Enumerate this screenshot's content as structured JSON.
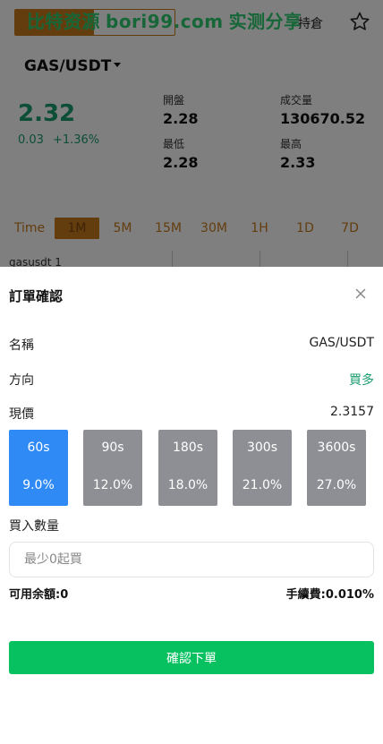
{
  "watermark": {
    "text_cn": "比特资源",
    "url": "bori99.com",
    "text_cn2": "实测分享"
  },
  "background": {
    "top_right_text": "持倉",
    "pair": "GAS/USDT",
    "price": "2.32",
    "change_abs": "0.03",
    "change_pct": "+1.36%",
    "stats": [
      {
        "label": "開盤",
        "value": "2.28"
      },
      {
        "label": "成交量",
        "value": "130670.52"
      },
      {
        "label": "最低",
        "value": "2.28"
      },
      {
        "label": "最高",
        "value": "2.33"
      }
    ],
    "intervals": [
      "Time",
      "1M",
      "5M",
      "15M",
      "30M",
      "1H",
      "1D",
      "7D"
    ],
    "active_interval": "1M",
    "sub_row": "gasusdt 1",
    "colors": {
      "accent": "#c77a1a",
      "up": "#1a9c6e"
    }
  },
  "modal": {
    "title": "訂單確認",
    "rows": [
      {
        "label": "名稱",
        "value": "GAS/USDT"
      },
      {
        "label": "方向",
        "value": "買多"
      },
      {
        "label": "現價",
        "value": "2.3157"
      }
    ],
    "periods": [
      {
        "time": "60s",
        "rate": "9.0%"
      },
      {
        "time": "90s",
        "rate": "12.0%"
      },
      {
        "time": "180s",
        "rate": "18.0%"
      },
      {
        "time": "300s",
        "rate": "21.0%"
      },
      {
        "time": "3600s",
        "rate": "27.0%"
      }
    ],
    "selected_period": "60s",
    "quantity_label": "買入數量",
    "quantity_placeholder": "最少0起買",
    "balance": "可用余額:0",
    "fee": "手續費:0.010%",
    "confirm_label": "確認下單",
    "colors": {
      "selected": "#2f8af5",
      "unselected": "#8e8f94",
      "confirm": "#07c160",
      "direction": "#1a9c6e"
    }
  }
}
